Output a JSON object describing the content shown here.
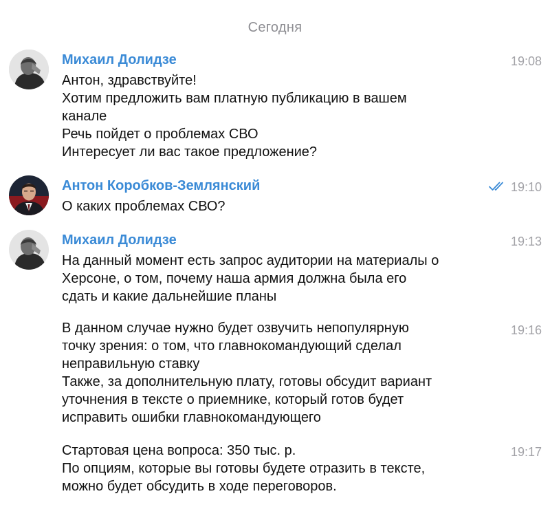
{
  "date_separator": "Сегодня",
  "messages": [
    {
      "sender": "Михаил Долидзе",
      "time": "19:08",
      "lines": [
        "Антон, здравствуйте!",
        "Хотим предложить вам платную публикацию в вашем",
        "канале",
        "Речь пойдет о проблемах СВО",
        "Интересует ли вас такое предложение?"
      ]
    },
    {
      "sender": "Антон Коробков-Землянский",
      "time": "19:10",
      "read_status": "double-check-icon",
      "lines": [
        "О каких проблемах СВО?"
      ]
    },
    {
      "sender": "Михаил Долидзе",
      "time": "19:13",
      "lines": [
        "На данный момент есть запрос аудитории на материалы о",
        "Херсоне, о том, почему наша армия должна была его",
        "сдать и какие дальнейшие планы"
      ]
    },
    {
      "time": "19:16",
      "lines": [
        "В данном случае нужно будет озвучить непопулярную",
        "точку зрения: о том, что главнокомандующий сделал",
        "неправильную ставку",
        "Также, за дополнительную плату, готовы обсудит вариант",
        "уточнения в тексте о приемнике, который готов будет",
        "исправить ошибки главнокомандующего"
      ]
    },
    {
      "time": "19:17",
      "lines": [
        "Стартовая цена вопроса: 350 тыс. р.",
        "По опциям, которые вы готовы будете отразить в тексте,",
        "можно будет обсудить в ходе переговоров."
      ]
    }
  ],
  "colors": {
    "sender_name": "#3a8ad6",
    "timestamp": "#a2a2a7",
    "read_checks": "#3a8ad6",
    "date_separator": "#8e8e93",
    "message_text": "#111111"
  }
}
